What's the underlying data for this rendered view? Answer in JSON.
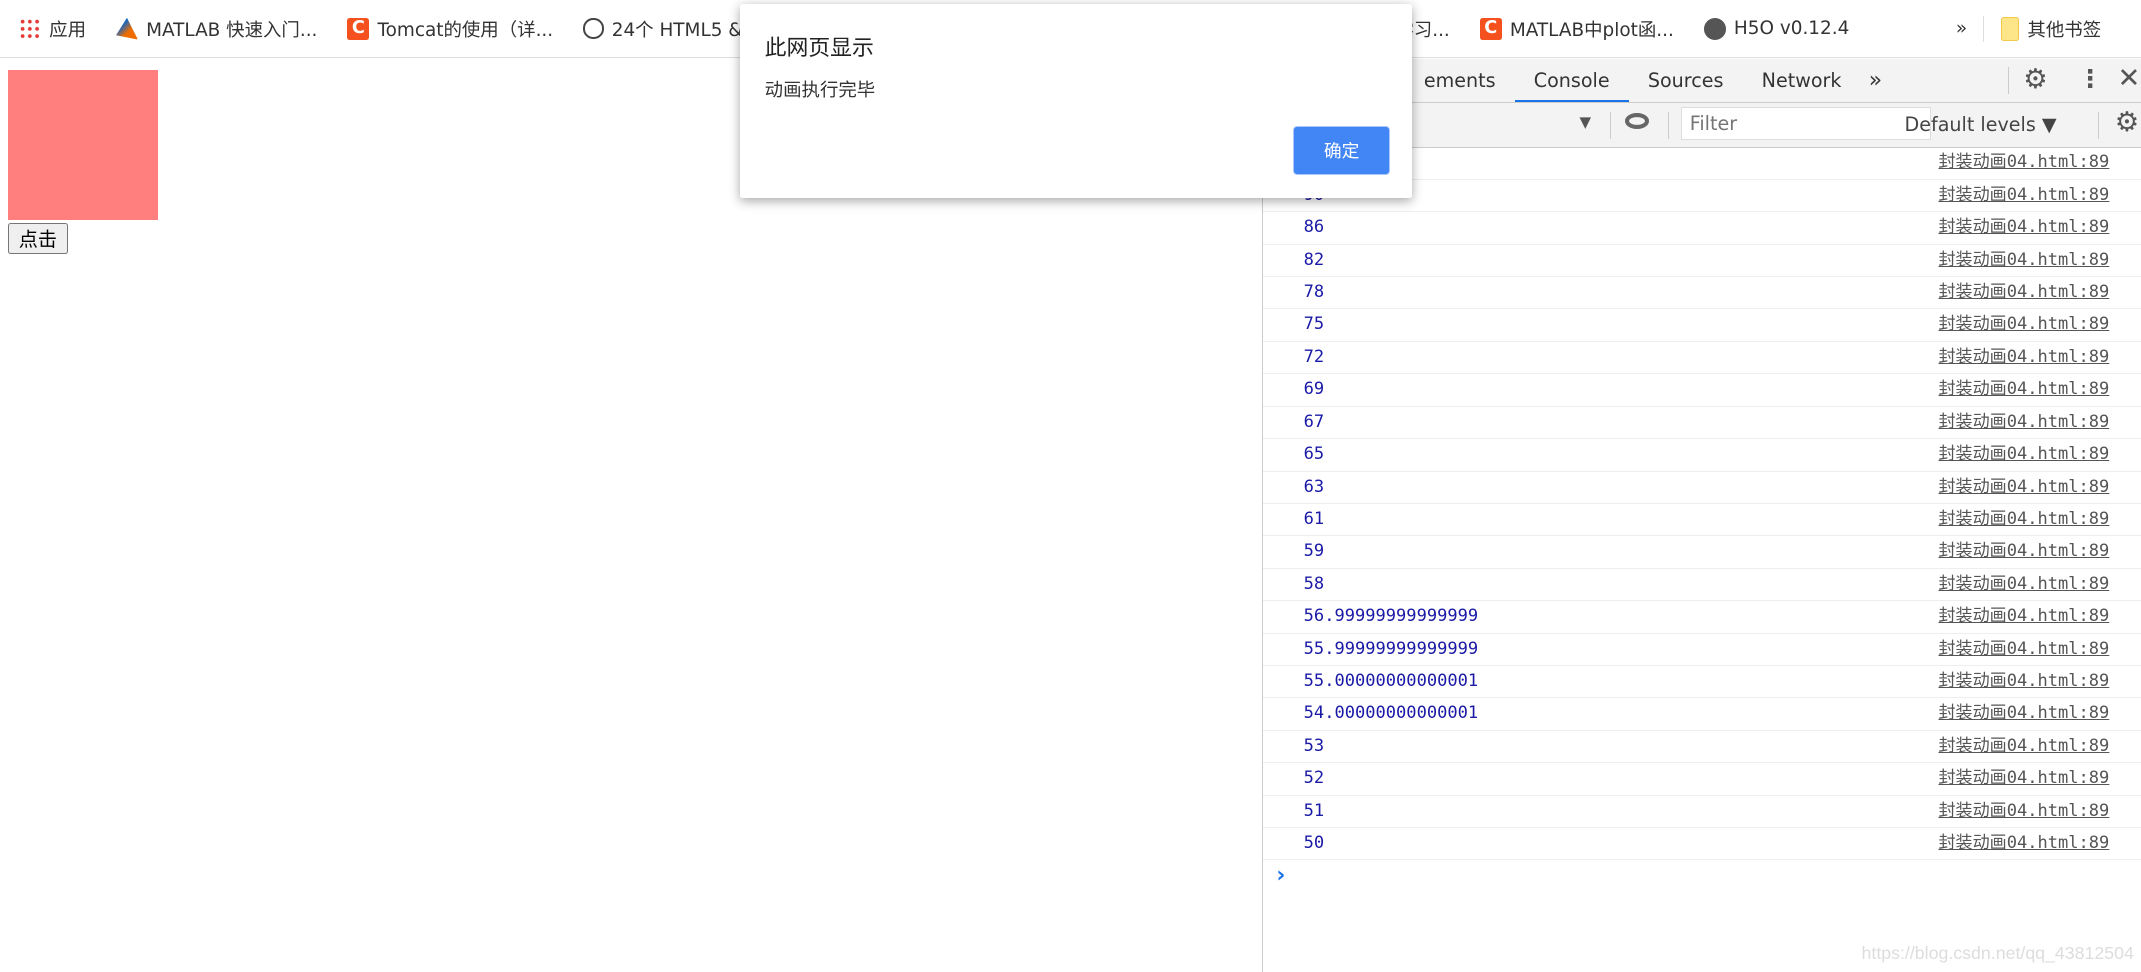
{
  "bookmarks": [
    {
      "label": "应用",
      "icon": "apps-grid-icon"
    },
    {
      "label": "MATLAB 快速入门...",
      "icon": "matlab-icon"
    },
    {
      "label": "Tomcat的使用（详...",
      "icon": "csdn-icon"
    },
    {
      "label": "24个 HTML5 &",
      "icon": "site-icon"
    },
    {
      "label": "学习...",
      "icon": ""
    },
    {
      "label": "MATLAB中plot函...",
      "icon": "csdn-icon"
    },
    {
      "label": "H5O v0.12.4",
      "icon": "globe-icon"
    }
  ],
  "bookmarks_more": "»",
  "other_bookmarks": "其他书签",
  "page": {
    "button_label": "点击",
    "box_color": "#ff7f7f"
  },
  "dialog": {
    "title": "此网页显示",
    "message": "动画执行完毕",
    "ok_label": "确定"
  },
  "devtools": {
    "tabs": [
      "ements",
      "Console",
      "Sources",
      "Network"
    ],
    "active_tab": "Console",
    "more_tabs": "»",
    "filter_placeholder": "Filter",
    "levels": "Default levels ▼",
    "logs": [
      "",
      "90",
      "86",
      "82",
      "78",
      "75",
      "72",
      "69",
      "67",
      "65",
      "63",
      "61",
      "59",
      "58",
      "56.99999999999999",
      "55.99999999999999",
      "55.00000000000001",
      "54.00000000000001",
      "53",
      "52",
      "51",
      "50"
    ],
    "source": "封装动画04.html:89",
    "prompt": "›"
  },
  "watermark": "https://blog.csdn.net/qq_43812504"
}
